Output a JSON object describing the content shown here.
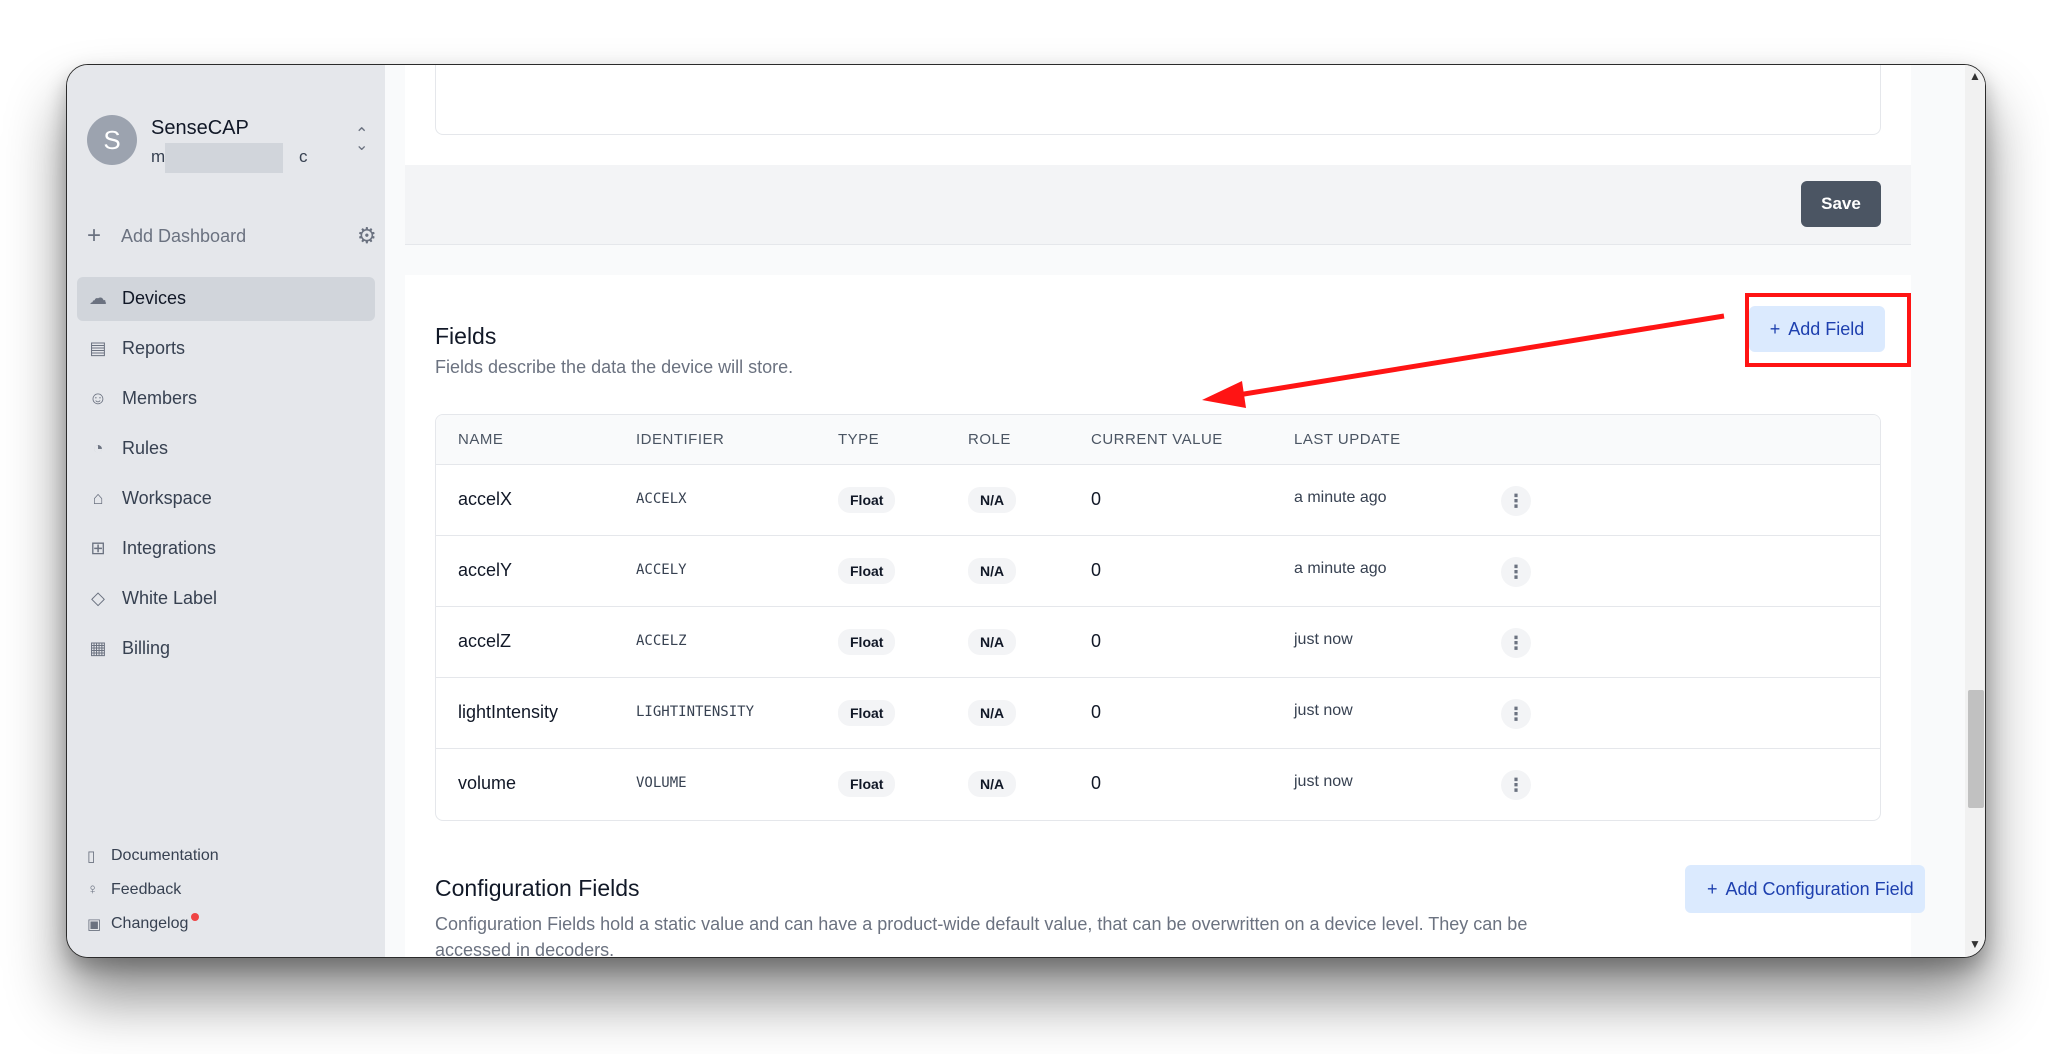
{
  "org": {
    "avatar_letter": "S",
    "name": "SenseCAP",
    "email_start": "m",
    "email_end": "c"
  },
  "sidebar": {
    "add_dashboard": "Add Dashboard",
    "items": [
      {
        "label": "Devices",
        "icon": "cloud-upload-icon"
      },
      {
        "label": "Reports",
        "icon": "document-icon"
      },
      {
        "label": "Members",
        "icon": "users-icon"
      },
      {
        "label": "Rules",
        "icon": "signal-icon"
      },
      {
        "label": "Workspace",
        "icon": "home-icon"
      },
      {
        "label": "Integrations",
        "icon": "plus-square-icon"
      },
      {
        "label": "White Label",
        "icon": "tag-icon"
      },
      {
        "label": "Billing",
        "icon": "billing-icon"
      }
    ],
    "footer": [
      {
        "label": "Documentation",
        "icon": "book-icon"
      },
      {
        "label": "Feedback",
        "icon": "lightbulb-icon"
      },
      {
        "label": "Changelog",
        "icon": "gift-icon"
      }
    ]
  },
  "top_card": {
    "save_label": "Save"
  },
  "fields": {
    "title": "Fields",
    "description": "Fields describe the data the device will store.",
    "add_label": "Add Field",
    "columns": [
      "NAME",
      "IDENTIFIER",
      "TYPE",
      "ROLE",
      "CURRENT VALUE",
      "LAST UPDATE"
    ],
    "rows": [
      {
        "name": "accelX",
        "identifier": "ACCELX",
        "type": "Float",
        "role": "N/A",
        "value": "0",
        "updated": "a minute ago"
      },
      {
        "name": "accelY",
        "identifier": "ACCELY",
        "type": "Float",
        "role": "N/A",
        "value": "0",
        "updated": "a minute ago"
      },
      {
        "name": "accelZ",
        "identifier": "ACCELZ",
        "type": "Float",
        "role": "N/A",
        "value": "0",
        "updated": "just now"
      },
      {
        "name": "lightIntensity",
        "identifier": "LIGHTINTENSITY",
        "type": "Float",
        "role": "N/A",
        "value": "0",
        "updated": "just now"
      },
      {
        "name": "volume",
        "identifier": "VOLUME",
        "type": "Float",
        "role": "N/A",
        "value": "0",
        "updated": "just now"
      }
    ]
  },
  "config": {
    "title": "Configuration Fields",
    "description": "Configuration Fields hold a static value and can have a product-wide default value, that can be overwritten on a device level. They can be accessed in decoders.",
    "add_label": "Add Configuration Field"
  },
  "colors": {
    "annotation": "#ff1414",
    "accent": "#1e40af",
    "accent_bg": "#dbeafe"
  }
}
